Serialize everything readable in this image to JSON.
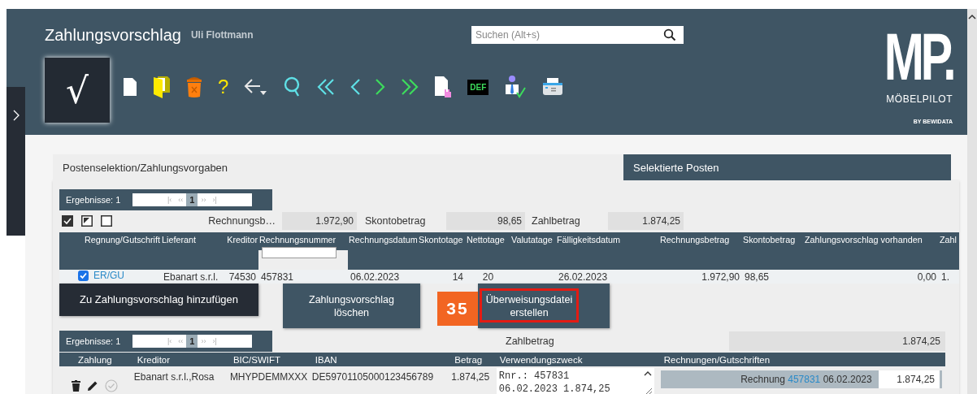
{
  "header": {
    "title": "Zahlungsvorschlag",
    "user": "Uli Flottmann",
    "search": {
      "placeholder": "Suchen (Alt+s)"
    },
    "confirm_button": "√",
    "toolbar": [
      {
        "kind": "page"
      },
      {
        "kind": "folder"
      },
      {
        "kind": "trash"
      },
      {
        "kind": "help",
        "text": "?"
      },
      {
        "kind": "back"
      },
      {
        "kind": "search"
      },
      {
        "kind": "first"
      },
      {
        "kind": "prev"
      },
      {
        "kind": "next"
      },
      {
        "kind": "last"
      },
      {
        "kind": "doc-hand"
      },
      {
        "kind": "def",
        "text": "DEF"
      },
      {
        "kind": "user-check"
      },
      {
        "kind": "printer"
      }
    ],
    "logo": {
      "mark": "MP.",
      "name": "MÖBELPILOT",
      "tagline": "BY BEWIDATA"
    }
  },
  "tabs": [
    {
      "label": "Postenselektion/Zahlungsvorgaben",
      "selected": true
    },
    {
      "label": "Selektierte Posten",
      "selected": false
    }
  ],
  "pager": {
    "label": "Ergebnisse: 1",
    "nav": [
      "|‹",
      "‹‹",
      "1",
      "››",
      "›|"
    ]
  },
  "selection_tools": [
    {
      "kind": "check-all"
    },
    {
      "kind": "invert"
    },
    {
      "kind": "none"
    }
  ],
  "totals": [
    {
      "label": "Rechnungsb…",
      "value": "1.972,90"
    },
    {
      "label": "Skontobetrag",
      "value": "98,65"
    },
    {
      "label": "Zahlbetrag",
      "value": "1.874,25"
    }
  ],
  "invoice_table": {
    "columns": [
      {
        "label": "Regnung/Gutschrift",
        "filter": false
      },
      {
        "label": "Lieferant",
        "filter": false
      },
      {
        "label": "Kreditor",
        "filter": false
      },
      {
        "label": "Rechnungsnummer",
        "filter": true
      },
      {
        "label": "Rechnungsdatum",
        "filter": false
      },
      {
        "label": "Skontotage",
        "filter": false
      },
      {
        "label": "Nettotage",
        "filter": false
      },
      {
        "label": "Valutatage",
        "filter": false
      },
      {
        "label": "Fälligkeitsdatum",
        "filter": false
      },
      {
        "label": "Rechnungsbetrag",
        "filter": false
      },
      {
        "label": "Skontobetrag",
        "filter": false
      },
      {
        "label": "Zahlungsvorschlag vorhanden",
        "filter": false
      },
      {
        "label": "Zahl",
        "filter": false
      }
    ],
    "rows": [
      {
        "selected": true,
        "cells": [
          "ER/GU",
          "Ebanart s.r.l.",
          "74530",
          "457831",
          "06.02.2023",
          "14",
          "20",
          null,
          "26.02.2023",
          "1.972,90",
          "98,65",
          "0,00",
          "1."
        ]
      }
    ]
  },
  "actions": [
    {
      "label": "Zu Zahlungsvorschlag hinzufügen",
      "kind": "dark"
    },
    {
      "label": "Zahlungsvorschlag löschen",
      "kind": "normal"
    },
    {
      "label": "Überweisungsdatei erstellen",
      "kind": "normal",
      "highlighted": true
    }
  ],
  "step_badge": "35",
  "pager2": {
    "label": "Ergebnisse: 1",
    "nav": [
      "|‹",
      "‹‹",
      "1",
      "››",
      "›|"
    ]
  },
  "payment_total": {
    "label": "Zahlbetrag",
    "value": "1.874,25"
  },
  "payment_table": {
    "columns": [
      "Zahlung",
      "Kreditor",
      "BIC/SWIFT",
      "IBAN",
      "Betrag",
      "Verwendungszweck",
      "Rechnungen/Gutschriften"
    ],
    "rows": [
      {
        "kreditor": "Ebanart s.r.l.,Rosa",
        "bic": "MHYPDEMMXXX",
        "iban": "DE59701105000123456789",
        "betrag": "1.874,25",
        "purpose": [
          "Rnr.: 457831",
          "06.02.2023 1.874,25"
        ],
        "invoice": {
          "type": "Rechnung",
          "number": "457831",
          "date": "06.02.2023",
          "amount": "1.874,25"
        }
      }
    ]
  }
}
